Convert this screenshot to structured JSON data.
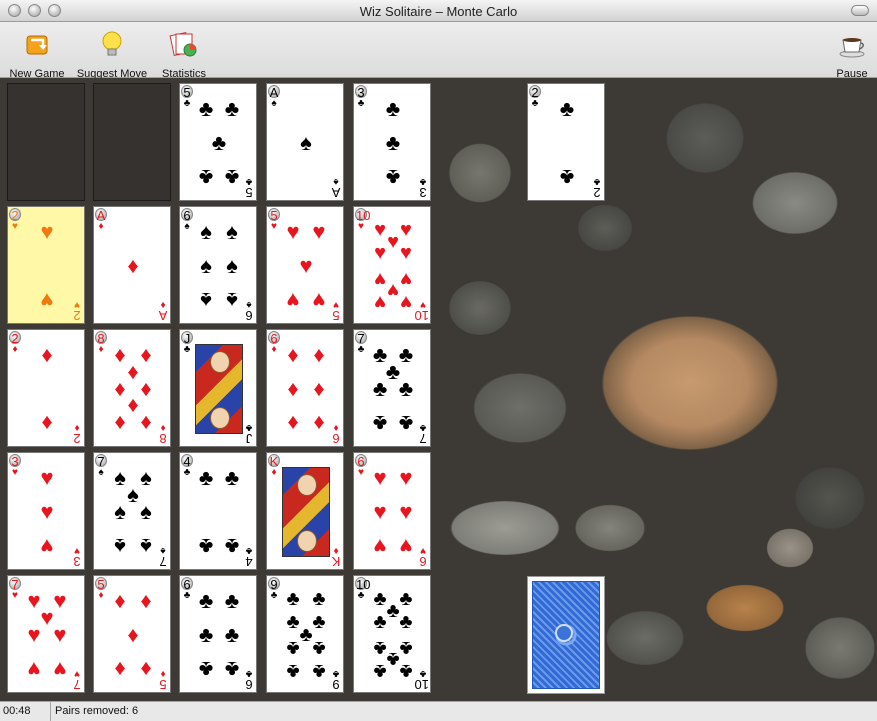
{
  "window": {
    "title": "Wiz Solitaire – Monte Carlo"
  },
  "toolbar": {
    "new_game": "New Game",
    "suggest_move": "Suggest Move",
    "statistics": "Statistics",
    "pause": "Pause"
  },
  "status": {
    "timer": "00:48",
    "pairs_removed": "Pairs removed: 6"
  },
  "suits": {
    "spade": "♠",
    "heart": "♥",
    "diamond": "♦",
    "club": "♣"
  },
  "colors": {
    "red": "#e8141e",
    "black": "#000000",
    "highlight": "#fff8a6"
  },
  "grid": [
    [
      {
        "empty": true
      },
      {
        "empty": true
      },
      {
        "rank": "5",
        "suit": "club"
      },
      {
        "rank": "A",
        "suit": "spade"
      },
      {
        "rank": "3",
        "suit": "club"
      }
    ],
    [
      {
        "rank": "2",
        "suit": "heart",
        "highlight": true
      },
      {
        "rank": "A",
        "suit": "diamond"
      },
      {
        "rank": "6",
        "suit": "spade"
      },
      {
        "rank": "5",
        "suit": "heart"
      },
      {
        "rank": "10",
        "suit": "heart"
      }
    ],
    [
      {
        "rank": "2",
        "suit": "diamond"
      },
      {
        "rank": "8",
        "suit": "diamond"
      },
      {
        "rank": "J",
        "suit": "club"
      },
      {
        "rank": "6",
        "suit": "diamond"
      },
      {
        "rank": "7",
        "suit": "club"
      }
    ],
    [
      {
        "rank": "3",
        "suit": "heart"
      },
      {
        "rank": "7",
        "suit": "spade"
      },
      {
        "rank": "4",
        "suit": "club"
      },
      {
        "rank": "K",
        "suit": "diamond"
      },
      {
        "rank": "6",
        "suit": "heart"
      }
    ],
    [
      {
        "rank": "7",
        "suit": "heart"
      },
      {
        "rank": "5",
        "suit": "diamond"
      },
      {
        "rank": "6",
        "suit": "club"
      },
      {
        "rank": "9",
        "suit": "club"
      },
      {
        "rank": "10",
        "suit": "club"
      }
    ]
  ],
  "foundation": {
    "rank": "2",
    "suit": "club"
  },
  "stock": {
    "face": "down"
  }
}
